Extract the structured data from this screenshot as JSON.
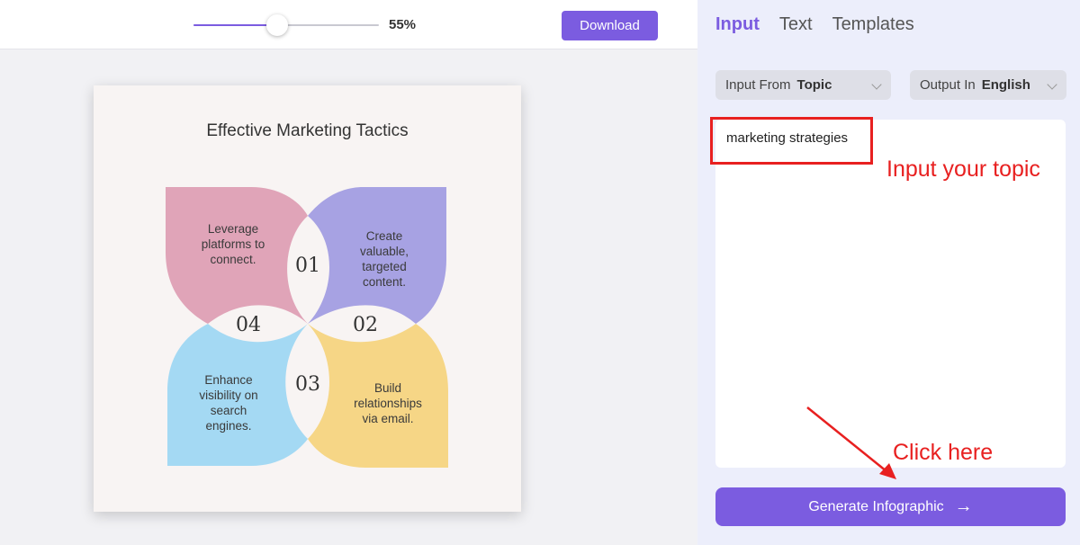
{
  "toolbar": {
    "zoom_label": "55%",
    "zoom_level_percent": 55,
    "download_label": "Download"
  },
  "infographic": {
    "title": "Effective Marketing Tactics",
    "items": [
      {
        "number": "01",
        "text": [
          "Leverage",
          "platforms to",
          "connect."
        ],
        "color": "#e0a4b8"
      },
      {
        "number": "02",
        "text": [
          "Create",
          "valuable,",
          "targeted",
          "content."
        ],
        "color": "#a7a2e3"
      },
      {
        "number": "03",
        "text": [
          "Build",
          "relationships",
          "via email."
        ],
        "color": "#f6d686"
      },
      {
        "number": "04",
        "text": [
          "Enhance",
          "visibility on",
          "search",
          "engines."
        ],
        "color": "#a4d9f3"
      }
    ]
  },
  "panel": {
    "tabs": [
      {
        "label": "Input",
        "active": true
      },
      {
        "label": "Text",
        "active": false
      },
      {
        "label": "Templates",
        "active": false
      }
    ],
    "input_from": {
      "label": "Input From",
      "value": "Topic"
    },
    "output_in": {
      "label": "Output In",
      "value": "English"
    },
    "topic_value": "marketing strategies",
    "generate_label": "Generate Infographic",
    "generate_arrow": "→"
  },
  "annotations": {
    "input_note": "Input your topic",
    "click_note": "Click here"
  },
  "colors": {
    "accent": "#7b5ce0",
    "annotation": "#e82020"
  }
}
